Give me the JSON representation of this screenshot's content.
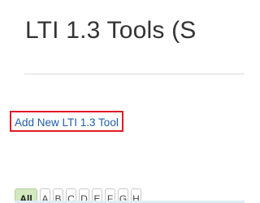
{
  "page": {
    "title": "LTI 1.3 Tools (S"
  },
  "actions": {
    "add_tool_label": "Add New LTI 1.3 Tool"
  },
  "letter_filter": {
    "selected": "All",
    "tabs": [
      "All",
      "A",
      "B",
      "C",
      "D",
      "E",
      "F",
      "G",
      "H"
    ]
  },
  "colors": {
    "highlight_box": "#e01b24",
    "link": "#1f5da8",
    "active_tab": "#d3e8bf"
  }
}
